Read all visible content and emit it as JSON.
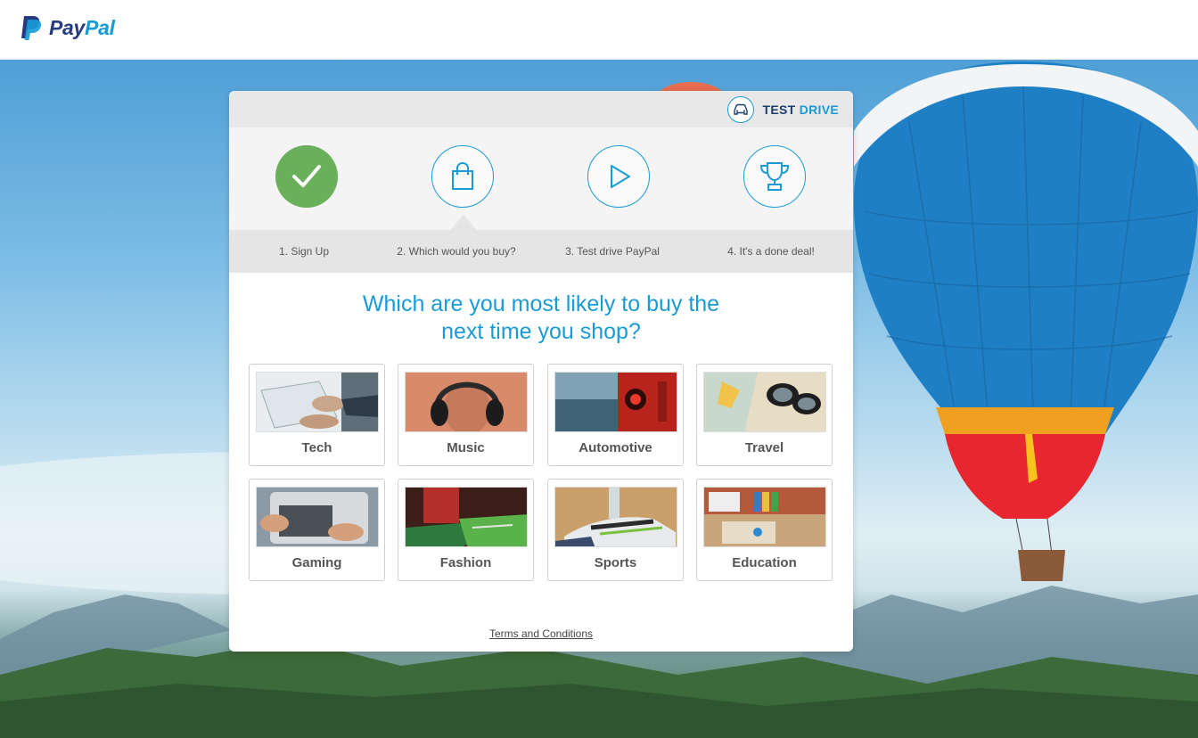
{
  "header": {
    "brand_pay": "Pay",
    "brand_pal": "Pal"
  },
  "card": {
    "badge_test": "TEST",
    "badge_drive": "DRIVE",
    "steps": [
      {
        "label": "1. Sign Up",
        "icon": "check-icon",
        "state": "completed"
      },
      {
        "label": "2. Which would you buy?",
        "icon": "shopping-bag-icon",
        "state": "current"
      },
      {
        "label": "3. Test drive PayPal",
        "icon": "play-icon",
        "state": "upcoming"
      },
      {
        "label": "4. It's a done deal!",
        "icon": "trophy-icon",
        "state": "upcoming"
      }
    ],
    "question_line1": "Which are you most likely to buy the",
    "question_line2": "next time you shop?",
    "categories": [
      {
        "label": "Tech"
      },
      {
        "label": "Music"
      },
      {
        "label": "Automotive"
      },
      {
        "label": "Travel"
      },
      {
        "label": "Gaming"
      },
      {
        "label": "Fashion"
      },
      {
        "label": "Sports"
      },
      {
        "label": "Education"
      }
    ],
    "terms_link": "Terms and Conditions"
  },
  "colors": {
    "accent": "#1a9ad6",
    "navy": "#253b80",
    "success": "#6aaf5a"
  }
}
